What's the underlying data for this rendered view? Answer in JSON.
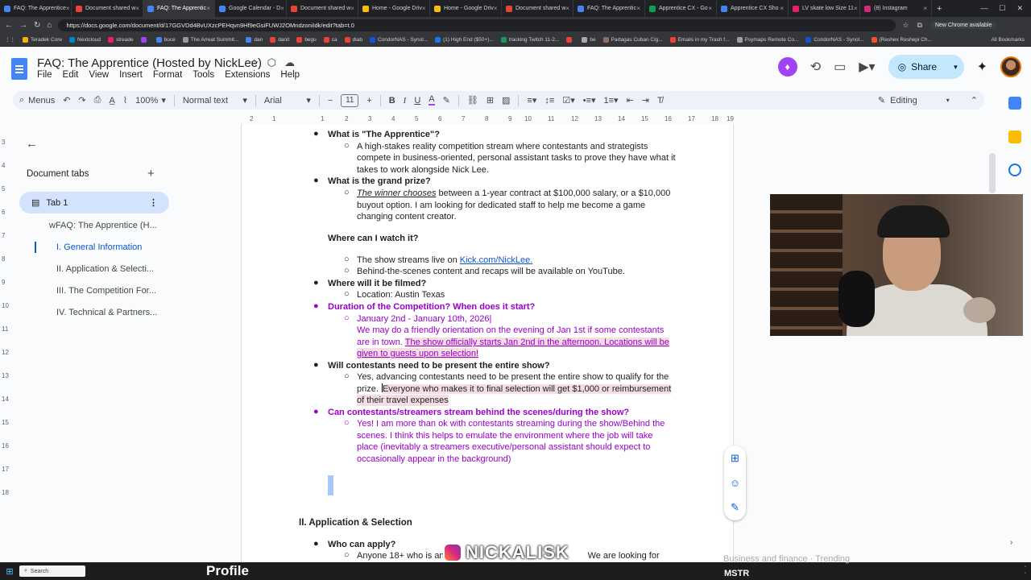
{
  "browser": {
    "tabs": [
      {
        "title": "FAQ: The Apprentice",
        "color": "#4285f4"
      },
      {
        "title": "Document shared w",
        "color": "#ea4335"
      },
      {
        "title": "FAQ: The Apprentic",
        "color": "#4285f4",
        "active": true
      },
      {
        "title": "Google Calendar - D",
        "color": "#4285f4"
      },
      {
        "title": "Document shared w",
        "color": "#ea4335"
      },
      {
        "title": "Home - Google Driv",
        "color": "#fbbc04"
      },
      {
        "title": "Home - Google Driv",
        "color": "#fbbc04"
      },
      {
        "title": "Document shared w",
        "color": "#ea4335"
      },
      {
        "title": "FAQ: The Apprentic",
        "color": "#4285f4"
      },
      {
        "title": "Apprentice CX - Go",
        "color": "#0f9d58"
      },
      {
        "title": "Apprentice CX Sho",
        "color": "#4285f4"
      },
      {
        "title": "LV skate low Size 11",
        "color": "#e91e63"
      },
      {
        "title": "(8) Instagram",
        "color": "#d62976"
      }
    ],
    "url": "https://docs.google.com/document/d/17GGVDd4BvUXzcPEHqvn9Hf9eGsiFUWJ2OMndzoniIdk/edit?tab=t.0",
    "chrome_update": "New Chrome available",
    "bookmarks": [
      {
        "label": "Teradek Core",
        "color": "#f4b400"
      },
      {
        "label": "Nextcloud",
        "color": "#0082c9"
      },
      {
        "label": "streade",
        "color": "#e91e63"
      },
      {
        "label": "",
        "color": "#a142f4"
      },
      {
        "label": "boce",
        "color": "#4285f4"
      },
      {
        "label": "The Arreat Summit...",
        "color": "#999999"
      },
      {
        "label": "dan",
        "color": "#4285f4"
      },
      {
        "label": "danit",
        "color": "#ea4335"
      },
      {
        "label": "begu",
        "color": "#ea4335"
      },
      {
        "label": "ca",
        "color": "#ea4335"
      },
      {
        "label": "diab",
        "color": "#ea4335"
      },
      {
        "label": "CondorNAS - Synol...",
        "color": "#0b57d0"
      },
      {
        "label": "(1) High End ($50+)...",
        "color": "#1877f2"
      },
      {
        "label": "tracking Twitch 11-2...",
        "color": "#0f9d58"
      },
      {
        "label": "",
        "color": "#ea4335"
      },
      {
        "label": "be",
        "color": "#aaaaaa"
      },
      {
        "label": "Partagas Cuban Cig...",
        "color": "#8d6e63"
      },
      {
        "label": "Emails in my Trash f...",
        "color": "#ea4335"
      },
      {
        "label": "Psymaps Remote Co...",
        "color": "#9e9e9e"
      },
      {
        "label": "CondorNAS - Synol...",
        "color": "#0b57d0"
      },
      {
        "label": "(Reshex Reshepi Ch...",
        "color": "#f4511e"
      }
    ],
    "all_bookmarks": "All Bookmarks"
  },
  "doc": {
    "title": "FAQ: The Apprentice (Hosted by NickLee)",
    "menu": [
      "File",
      "Edit",
      "View",
      "Insert",
      "Format",
      "Tools",
      "Extensions",
      "Help"
    ],
    "share_label": "Share",
    "toolbar": {
      "menus": "Menus",
      "zoom": "100%",
      "style": "Normal text",
      "font": "Arial",
      "font_size": "11",
      "mode": "Editing"
    }
  },
  "outline": {
    "tabs_title": "Document tabs",
    "tab1": "Tab 1",
    "items": [
      "wFAQ: The Apprentice (H...",
      "I. General Information",
      "II. Application & Selecti...",
      "III. The Competition For...",
      "IV. Technical & Partners..."
    ]
  },
  "ruler": {
    "h": [
      "2",
      "1",
      "1",
      "2",
      "3",
      "4",
      "5",
      "6",
      "7",
      "8",
      "9",
      "10",
      "11",
      "12",
      "13",
      "14",
      "15",
      "16",
      "17",
      "18",
      "19"
    ],
    "v": [
      "3",
      "4",
      "5",
      "6",
      "7",
      "8",
      "9",
      "10",
      "11",
      "12",
      "13",
      "14",
      "15",
      "16",
      "17",
      "18"
    ]
  },
  "content": {
    "q1": "What is \"The Apprentice\"?",
    "a1_1": "A high-stakes reality competition stream where contestants and strategists",
    "a1_2": "compete in business-oriented, personal assistant tasks to prove they have what it",
    "a1_3": "takes to work alongside Nick Lee.",
    "q2": "What is the grand prize?",
    "a2_1a": "The winner chooses",
    "a2_1b": " between a 1-year contract at $100,000 salary, or a $10,000",
    "a2_2": "buyout option.  I am looking for dedicated staff to help me become a game",
    "a2_3": "changing content creator.",
    "q3": "Where can I watch it?",
    "a3_1a": "The show streams live on ",
    "a3_1b": "Kick.com/NickLee.",
    "a3_2": "Behind-the-scenes content and recaps will be available on YouTube.",
    "q4": "Where will it be filmed?",
    "a4_1": "Location: Austin Texas",
    "q5": "Duration of the Competition?  When does it start?",
    "a5_1": "January 2nd - January 10th, 2026|",
    "a5_2": "We may do a friendly orientation on the evening of Jan 1st if some contestants",
    "a5_3a": "are in town.  ",
    "a5_3b": "The show officially starts Jan 2nd in the afternoon.  Locations will be",
    "a5_4": "given to guests upon selection!",
    "q6": "Will contestants need to be present the entire show?",
    "a6_1": "Yes, advancing contestants need to be present the entire show to qualify for the",
    "a6_2a": "prize.  ",
    "a6_2b": "Everyone who makes it to final selection will get $1,000 or reimbursement",
    "a6_3": "of their travel expenses",
    "q7": "Can contestants/streamers stream behind the scenes/during the show?",
    "a7_1": "Yes!  I am more than ok with contestants streaming during the show/Behind the",
    "a7_2": "scenes.  I think this helps to emulate the environment where the job will take",
    "a7_3": "place (inevitably a streamers executive/personal assistant should expect to",
    "a7_4": "occasionally appear in the background)",
    "h2": "II. Application & Selection",
    "q8": "Who can apply?",
    "a8_1a": "Anyone 18+ who is an",
    "a8_1b": "We are looking for"
  },
  "overlay": {
    "watermark": "NICKALISK",
    "taskbar_search": "Search",
    "taskbar_profile": "Profile",
    "trend": "Business and finance · Trending",
    "ticker": "MSTR"
  },
  "colors": {
    "accent": "#9900cc",
    "link": "#1155cc",
    "share": "#c2e7ff",
    "tabsel": "#d3e3fd"
  }
}
